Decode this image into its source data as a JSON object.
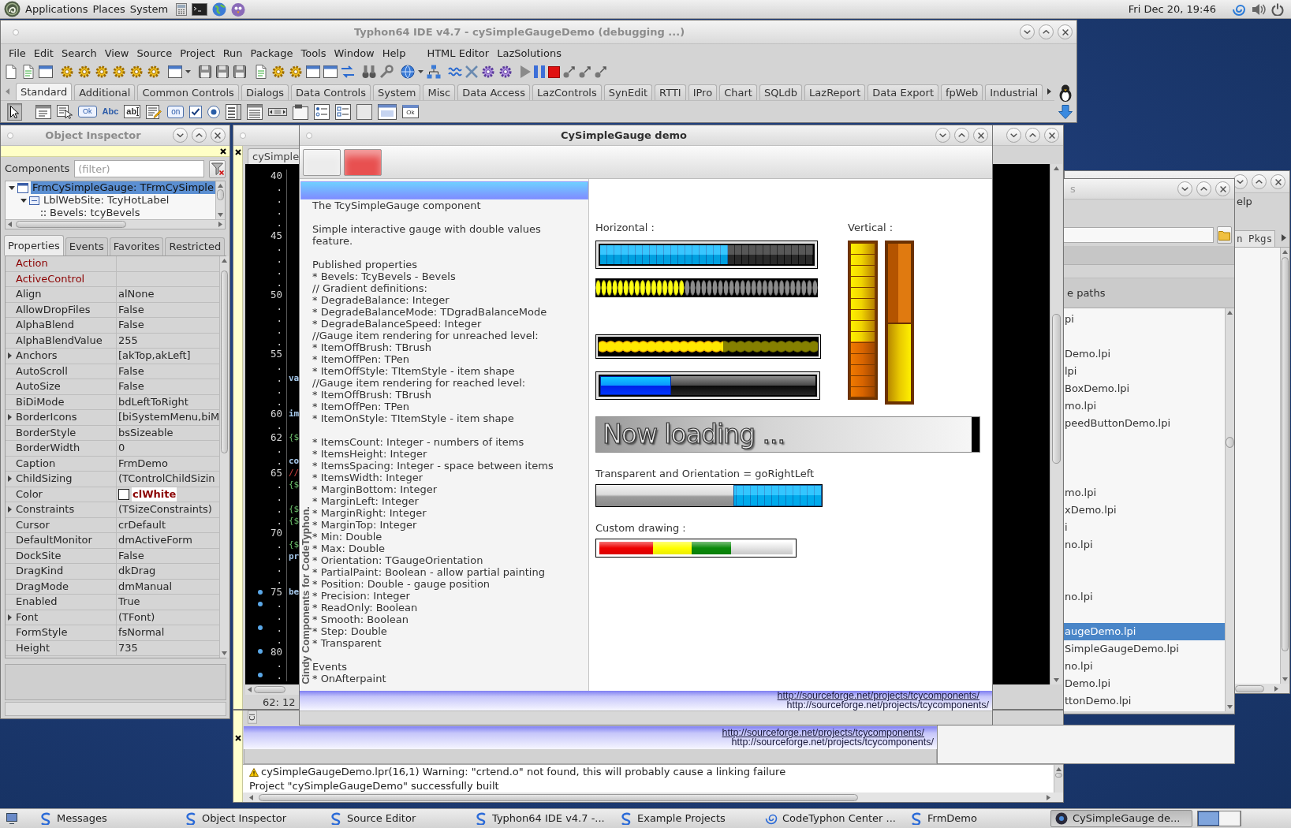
{
  "top_panel": {
    "menus": [
      "Applications",
      "Places",
      "System"
    ],
    "clock": "Fri Dec 20, 19:46"
  },
  "ide": {
    "title": "Typhon64 IDE v4.7 - cySimpleGaugeDemo (debugging ...)",
    "menu": [
      "File",
      "Edit",
      "Search",
      "View",
      "Source",
      "Project",
      "Run",
      "Package",
      "Tools",
      "Window",
      "Help"
    ],
    "addon_menu": [
      "HTML Editor",
      "LazSolutions"
    ],
    "palette_tabs": [
      {
        "label": "Standard",
        "selected": true
      },
      {
        "label": "Additional",
        "selected": false
      },
      {
        "label": "Common Controls",
        "selected": false
      },
      {
        "label": "Dialogs",
        "selected": false
      },
      {
        "label": "Data Controls",
        "selected": false
      },
      {
        "label": "System",
        "selected": false
      },
      {
        "label": "Misc",
        "selected": false
      },
      {
        "label": "Data Access",
        "selected": false
      },
      {
        "label": "LazControls",
        "selected": false
      },
      {
        "label": "SynEdit",
        "selected": false
      },
      {
        "label": "RTTI",
        "selected": false
      },
      {
        "label": "IPro",
        "selected": false
      },
      {
        "label": "Chart",
        "selected": false
      },
      {
        "label": "SQLdb",
        "selected": false
      },
      {
        "label": "LazReport",
        "selected": false
      },
      {
        "label": "Data Export",
        "selected": false
      },
      {
        "label": "fpWeb",
        "selected": false
      },
      {
        "label": "Industrial",
        "selected": false
      }
    ],
    "components": [
      {
        "kind": "pointer",
        "selected": true
      },
      {
        "kind": "menu",
        "selected": false
      },
      {
        "kind": "popup",
        "selected": false
      },
      {
        "kind": "button",
        "glyph": "Ok",
        "selected": false
      },
      {
        "kind": "label",
        "glyph": "Abc",
        "selected": false
      },
      {
        "kind": "edit",
        "glyph": "ab",
        "selected": false
      },
      {
        "kind": "memo",
        "selected": false
      },
      {
        "kind": "toggle",
        "glyph": "on",
        "selected": false
      },
      {
        "kind": "check",
        "selected": false
      },
      {
        "kind": "radio",
        "selected": false
      },
      {
        "kind": "list",
        "selected": false
      },
      {
        "kind": "lines",
        "selected": false
      },
      {
        "kind": "scroll",
        "selected": false
      },
      {
        "kind": "group",
        "selected": false
      },
      {
        "kind": "radiogroup",
        "selected": false
      },
      {
        "kind": "checkgroup",
        "selected": false
      },
      {
        "kind": "panel",
        "selected": false
      },
      {
        "kind": "frame",
        "selected": false
      },
      {
        "kind": "actions",
        "glyph": "Ok",
        "selected": false
      }
    ]
  },
  "object_inspector": {
    "title": "Object Inspector",
    "components_label": "Components",
    "filter": {
      "placeholder": "(filter)"
    },
    "tree": [
      {
        "label": "FrmCySimpleGauge: TFrmCySimple",
        "selected": true,
        "expanded": true,
        "children": [
          {
            "label": "LblWebSite: TcyHotLabel",
            "selected": false,
            "expanded": true,
            "children": [
              {
                "label": "Bevels: tcyBevels",
                "selected": false
              }
            ]
          }
        ]
      }
    ],
    "tabs": [
      {
        "label": "Properties",
        "selected": true
      },
      {
        "label": "Events",
        "selected": false
      },
      {
        "label": "Favorites",
        "selected": false
      },
      {
        "label": "Restricted",
        "selected": false
      }
    ],
    "properties": [
      {
        "name": "Action",
        "kind": "reference",
        "expandable": false
      },
      {
        "name": "ActiveControl",
        "kind": "reference",
        "expandable": false
      },
      {
        "name": "Align",
        "value": "alNone",
        "kind": "plain",
        "expandable": false
      },
      {
        "name": "AllowDropFiles",
        "value": "False",
        "kind": "plain",
        "expandable": false
      },
      {
        "name": "AlphaBlend",
        "value": "False",
        "kind": "plain",
        "expandable": false
      },
      {
        "name": "AlphaBlendValue",
        "value": "255",
        "kind": "plain",
        "expandable": false
      },
      {
        "name": "Anchors",
        "value": "[akTop,akLeft]",
        "kind": "plain",
        "expandable": true
      },
      {
        "name": "AutoScroll",
        "value": "False",
        "kind": "plain",
        "expandable": false
      },
      {
        "name": "AutoSize",
        "value": "False",
        "kind": "plain",
        "expandable": false
      },
      {
        "name": "BiDiMode",
        "value": "bdLeftToRight",
        "kind": "plain",
        "expandable": false
      },
      {
        "name": "BorderIcons",
        "value": "[biSystemMenu,biM",
        "kind": "plain",
        "expandable": true
      },
      {
        "name": "BorderStyle",
        "value": "bsSizeable",
        "kind": "plain",
        "expandable": false
      },
      {
        "name": "BorderWidth",
        "value": "0",
        "kind": "plain",
        "expandable": false
      },
      {
        "name": "Caption",
        "value": "FrmDemo",
        "kind": "plain",
        "expandable": false
      },
      {
        "name": "ChildSizing",
        "value": "(TControlChildSizin",
        "kind": "plain",
        "expandable": true
      },
      {
        "name": "Color",
        "value": "clWhite",
        "kind": "color",
        "color": "#ffffff",
        "expandable": false
      },
      {
        "name": "Constraints",
        "value": "(TSizeConstraints)",
        "kind": "plain",
        "expandable": true
      },
      {
        "name": "Cursor",
        "value": "crDefault",
        "kind": "plain",
        "expandable": false
      },
      {
        "name": "DefaultMonitor",
        "value": "dmActiveForm",
        "kind": "plain",
        "expandable": false
      },
      {
        "name": "DockSite",
        "value": "False",
        "kind": "plain",
        "expandable": false
      },
      {
        "name": "DragKind",
        "value": "dkDrag",
        "kind": "plain",
        "expandable": false
      },
      {
        "name": "DragMode",
        "value": "dmManual",
        "kind": "plain",
        "expandable": false
      },
      {
        "name": "Enabled",
        "value": "True",
        "kind": "plain",
        "expandable": false
      },
      {
        "name": "Font",
        "value": "(TFont)",
        "kind": "plain",
        "expandable": true
      },
      {
        "name": "FormStyle",
        "value": "fsNormal",
        "kind": "plain",
        "expandable": false
      },
      {
        "name": "Height",
        "value": "735",
        "kind": "plain",
        "expandable": false
      }
    ]
  },
  "source_editor": {
    "tab": "cySimple",
    "lines": [
      {
        "number": "40",
        "marker": false
      },
      {
        "number": ".",
        "marker": false
      },
      {
        "number": ".",
        "marker": false
      },
      {
        "number": ".",
        "marker": false
      },
      {
        "number": ".",
        "marker": false
      },
      {
        "number": "45",
        "marker": false
      },
      {
        "number": ".",
        "marker": false
      },
      {
        "number": ".",
        "marker": false
      },
      {
        "number": ".",
        "marker": false
      },
      {
        "number": ".",
        "marker": false
      },
      {
        "number": "50",
        "marker": false
      },
      {
        "number": ".",
        "marker": false
      },
      {
        "number": ".",
        "marker": false
      },
      {
        "number": ".",
        "marker": false
      },
      {
        "number": ".",
        "marker": false
      },
      {
        "number": "55",
        "marker": false
      },
      {
        "number": ".",
        "marker": false
      },
      {
        "number": ".",
        "code": "va",
        "kind": "keyword",
        "marker": false
      },
      {
        "number": ".",
        "marker": false
      },
      {
        "number": ".",
        "marker": false
      },
      {
        "number": "60",
        "code": "im",
        "kind": "keyword",
        "marker": false
      },
      {
        "number": ".",
        "marker": false
      },
      {
        "number": "62",
        "code": "{$",
        "kind": "directive",
        "marker": false
      },
      {
        "number": ".",
        "marker": false
      },
      {
        "number": ".",
        "code": "co",
        "kind": "keyword",
        "marker": false
      },
      {
        "number": "65",
        "code": "//",
        "kind": "comment",
        "marker": false
      },
      {
        "number": ".",
        "code": "{$",
        "kind": "directive",
        "marker": false
      },
      {
        "number": ".",
        "marker": false
      },
      {
        "number": ".",
        "code": "{$",
        "kind": "directive",
        "marker": false
      },
      {
        "number": ".",
        "code": "{$",
        "kind": "directive",
        "marker": false
      },
      {
        "number": "70",
        "marker": false
      },
      {
        "number": ".",
        "code": "{$",
        "kind": "directive",
        "marker": false
      },
      {
        "number": ".",
        "code": "pr",
        "kind": "keyword",
        "marker": false
      },
      {
        "number": ".",
        "marker": false
      },
      {
        "number": ".",
        "marker": false
      },
      {
        "number": "75",
        "code": "be",
        "kind": "keyword",
        "marker": true
      },
      {
        "number": ".",
        "marker": true
      },
      {
        "number": ".",
        "marker": false
      },
      {
        "number": ".",
        "marker": true
      },
      {
        "number": ".",
        "marker": false
      },
      {
        "number": "80",
        "marker": true
      },
      {
        "number": ".",
        "marker": false
      },
      {
        "number": ".",
        "marker": true
      }
    ],
    "cursor": "62: 12"
  },
  "messages": {
    "side_tab": "Cl",
    "items": [
      {
        "kind": "warning",
        "text": "cySimpleGaugeDemo.lpr(16,1) Warning: \"crtend.o\" not found, this will probably cause a linking failure"
      },
      {
        "kind": "info",
        "text": "Project \"cySimpleGaugeDemo\" successfully built"
      }
    ]
  },
  "overlay_strip": {
    "links": [
      "http://sourceforge.net/projects/tcycomponents/",
      "http://sourceforge.net/projects/tcycomponents/"
    ]
  },
  "demo": {
    "title": "CySimpleGauge demo",
    "toolbar_buttons": [
      {
        "color": "#ececec"
      },
      {
        "color": "#e85050"
      }
    ],
    "side_caption": "Cindy Components for CodeTyphon.",
    "memo": [
      [
        "The TcySimpleGauge component"
      ],
      [
        "Simple interactive gauge with double values feature."
      ],
      [
        "Published properties",
        "* Bevels: TcyBevels - Bevels",
        "// Gradient definitions:",
        "* DegradeBalance: Integer",
        "* DegradeBalanceMode: TDgradBalanceMode",
        "* DegradeBalanceSpeed: Integer",
        "//Gauge item rendering for unreached level:",
        "* ItemOffBrush: TBrush",
        "* ItemOffPen: TPen",
        "* ItemOffStyle: TItemStyle - item shape",
        "//Gauge item rendering for reached level:",
        "* ItemOffBrush: TBrush",
        "* ItemOffPen: TPen",
        "* ItemOnStyle: TItemStyle - item shape"
      ],
      [
        "* ItemsCount: Integer - numbers of items",
        "* ItemsHeight: Integer",
        "* ItemsSpacing: Integer - space between items",
        "* ItemsWidth: Integer",
        "* MarginBottom: Integer",
        "* MarginLeft: Integer",
        "* MarginRight: Integer",
        "* MarginTop: Integer",
        "* Min: Double",
        "* Max: Double",
        "* Orientation: TGaugeOrientation",
        "* PartialPaint: Boolean - allow partial painting",
        "* Position: Double - gauge position",
        "* Precision: Integer",
        "* ReadOnly: Boolean",
        "* Smooth: Boolean",
        "* Step: Double",
        "* Transparent"
      ],
      [
        "Events",
        "* OnAfterpaint"
      ]
    ],
    "horizontal": {
      "label": "Horizontal :",
      "gauges": [
        {
          "kind": "blocks",
          "level": 0.6
        },
        {
          "kind": "pills",
          "level": 0.4
        },
        {
          "kind": "dots",
          "level": 0.57
        },
        {
          "kind": "smooth",
          "level": 0.33
        }
      ]
    },
    "vertical": {
      "label": "Vertical :",
      "gauges": [
        {
          "kind": "vblocks",
          "level": 0.64
        },
        {
          "kind": "vsmooth",
          "level": 0.5
        }
      ]
    },
    "loading": {
      "caption": "Now loading ...",
      "level": 0.98
    },
    "transparent": {
      "label": "Transparent and Orientation = goRightLeft",
      "gauge": {
        "kind": "reverse",
        "level": 0.39
      }
    },
    "custom": {
      "label": "Custom drawing :",
      "gauge": {
        "kind": "bands",
        "level": 0.68
      }
    },
    "links": [
      "http://sourceforge.net/projects/tcycomponents/",
      "http://sourceforge.net/projects/tcycomponents/"
    ]
  },
  "center_window": {
    "menu_item": "elp",
    "tab": "n Pkgs"
  },
  "projects_window": {
    "title": "s",
    "header": "e paths",
    "rows": [
      {
        "label": "pi",
        "selected": false
      },
      {
        "selected": false
      },
      {
        "label": "Demo.lpi",
        "selected": false
      },
      {
        "label": "lpi",
        "selected": false
      },
      {
        "label": "BoxDemo.lpi",
        "selected": false
      },
      {
        "label": "mo.lpi",
        "selected": false
      },
      {
        "label": "peedButtonDemo.lpi",
        "selected": false
      },
      {
        "selected": false
      },
      {
        "selected": false
      },
      {
        "selected": false
      },
      {
        "label": "mo.lpi",
        "selected": false
      },
      {
        "label": "xDemo.lpi",
        "selected": false
      },
      {
        "label": "i",
        "selected": false
      },
      {
        "label": "no.lpi",
        "selected": false
      },
      {
        "selected": false
      },
      {
        "selected": false
      },
      {
        "label": "no.lpi",
        "selected": false
      },
      {
        "selected": false
      },
      {
        "label": "augeDemo.lpi",
        "selected": true
      },
      {
        "label": "SimpleGaugeDemo.lpi",
        "selected": false
      },
      {
        "label": "no.lpi",
        "selected": false
      },
      {
        "label": "Demo.lpi",
        "selected": false
      },
      {
        "label": "ttonDemo.lpi",
        "selected": false
      }
    ]
  },
  "taskbar": {
    "items": [
      {
        "label": "Messages",
        "kind": "typhon",
        "selected": false
      },
      {
        "label": "Object Inspector",
        "kind": "typhon",
        "selected": false
      },
      {
        "label": "Source Editor",
        "kind": "typhon",
        "selected": false
      },
      {
        "label": "Typhon64 IDE v4.7 -...",
        "kind": "typhon",
        "selected": false
      },
      {
        "label": "Example Projects",
        "kind": "typhon",
        "selected": false
      },
      {
        "label": "CodeTyphon Center ...",
        "kind": "center",
        "selected": false
      },
      {
        "label": "FrmDemo",
        "kind": "typhon",
        "selected": false
      },
      {
        "label": "CySimpleGauge de...",
        "kind": "app",
        "selected": true
      }
    ],
    "workspaces": [
      {
        "selected": true
      },
      {
        "selected": false
      }
    ]
  }
}
